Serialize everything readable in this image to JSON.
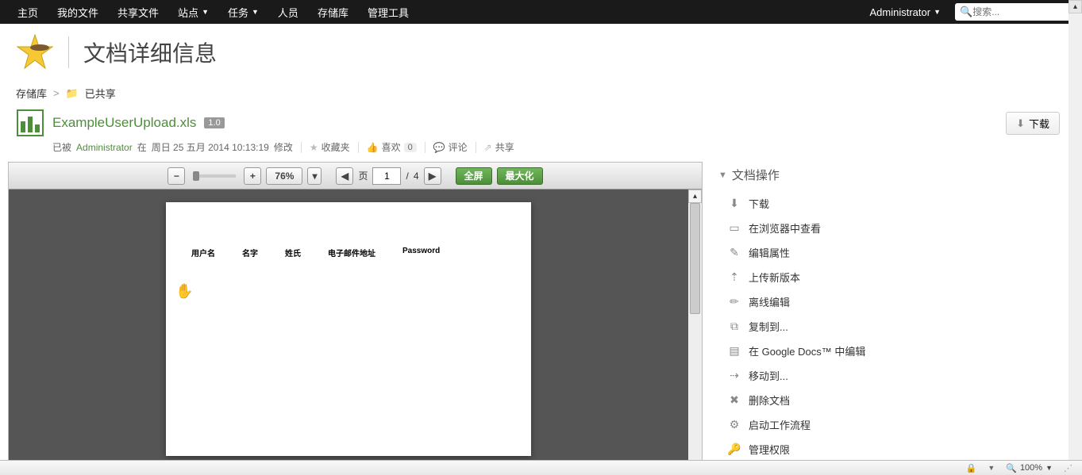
{
  "nav": {
    "items": [
      "主页",
      "我的文件",
      "共享文件",
      "站点",
      "任务",
      "人员",
      "存储库",
      "管理工具"
    ],
    "dropdown_idx": [
      3,
      4
    ],
    "user": "Administrator",
    "search_placeholder": "搜索..."
  },
  "page": {
    "title": "文档详细信息"
  },
  "breadcrumb": {
    "root": "存储库",
    "sep": ">",
    "current": "已共享"
  },
  "doc": {
    "name": "ExampleUserUpload.xls",
    "version": "1.0",
    "download_btn": "下载",
    "meta_prefix": "已被",
    "meta_user": "Administrator",
    "meta_at": "在",
    "meta_date": "周日 25 五月 2014 10:13:19",
    "meta_suffix": "修改",
    "fav": "收藏夹",
    "like": "喜欢",
    "like_count": "0",
    "comment": "评论",
    "share": "共享"
  },
  "preview": {
    "zoom": "76%",
    "page_label": "页",
    "page_cur": "1",
    "page_sep": "/",
    "page_total": "4",
    "fullscreen": "全屏",
    "maximize": "最大化",
    "columns": [
      "用户名",
      "名字",
      "姓氏",
      "电子邮件地址",
      "Password"
    ]
  },
  "side": {
    "header": "文档操作",
    "items": [
      {
        "icon": "download",
        "label": "下载"
      },
      {
        "icon": "browser",
        "label": "在浏览器中查看"
      },
      {
        "icon": "edit",
        "label": "编辑属性"
      },
      {
        "icon": "upload",
        "label": "上传新版本"
      },
      {
        "icon": "offline",
        "label": "离线编辑"
      },
      {
        "icon": "copy",
        "label": "复制到..."
      },
      {
        "icon": "gdocs",
        "label": "在 Google Docs™ 中编辑"
      },
      {
        "icon": "move",
        "label": "移动到..."
      },
      {
        "icon": "delete",
        "label": "删除文档"
      },
      {
        "icon": "workflow",
        "label": "启动工作流程"
      },
      {
        "icon": "perm",
        "label": "管理权限"
      }
    ]
  },
  "status": {
    "zoom": "100%"
  }
}
